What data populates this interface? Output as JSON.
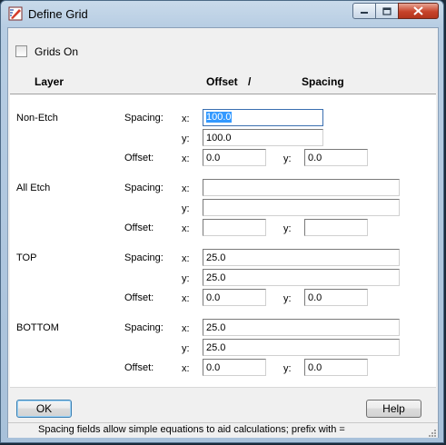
{
  "window": {
    "title": "Define Grid"
  },
  "grids_on": {
    "label": "Grids On",
    "checked": false
  },
  "headers": {
    "layer": "Layer",
    "offset": "Offset",
    "slash": "/",
    "spacing": "Spacing"
  },
  "labels": {
    "spacing": "Spacing:",
    "offset": "Offset:",
    "x": "x:",
    "y": "y:"
  },
  "layers": [
    {
      "name": "Non-Etch",
      "spacing_x": "100.0",
      "spacing_y": "100.0",
      "offset_x": "0.0",
      "offset_y": "0.0"
    },
    {
      "name": "All Etch",
      "spacing_x": "",
      "spacing_y": "",
      "offset_x": "",
      "offset_y": ""
    },
    {
      "name": "TOP",
      "spacing_x": "25.0",
      "spacing_y": "25.0",
      "offset_x": "0.0",
      "offset_y": "0.0"
    },
    {
      "name": "BOTTOM",
      "spacing_x": "25.0",
      "spacing_y": "25.0",
      "offset_x": "0.0",
      "offset_y": "0.0"
    }
  ],
  "buttons": {
    "ok": "OK",
    "help": "Help"
  },
  "status": {
    "text": "Spacing fields allow simple equations to aid calculations; prefix with ="
  },
  "colors": {
    "selection": "#3399ff",
    "focus_border": "#3a6fb0",
    "close_button": "#c7442a"
  }
}
